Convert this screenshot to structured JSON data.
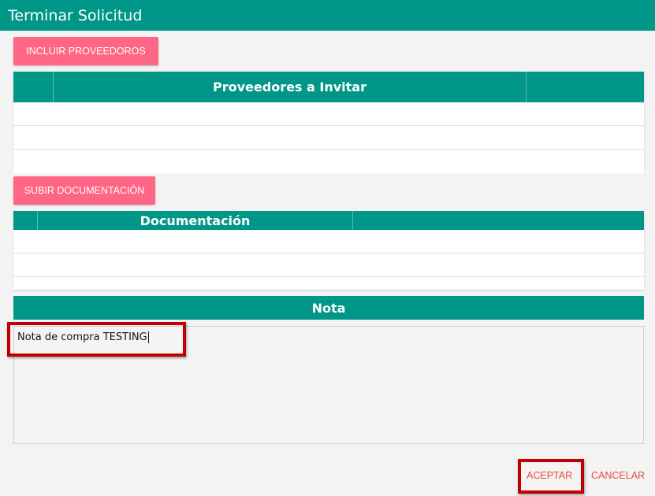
{
  "dialog": {
    "title": "Terminar Solicitud"
  },
  "proveedores": {
    "button_label": "INCLUIR PROVEEDOROS",
    "table_header": "Proveedores a Invitar",
    "rows": 3
  },
  "documentacion": {
    "button_label": "SUBIR DOCUMENTACIÓN",
    "table_header": "Documentación",
    "rows": 2
  },
  "nota": {
    "header": "Nota",
    "value": "Nota de compra TESTING"
  },
  "footer": {
    "accept_label": "ACEPTAR",
    "cancel_label": "CANCELAR"
  },
  "colors": {
    "primary": "#009688",
    "pink": "#ff6584",
    "danger_text": "#e84d3d",
    "highlight": "#c00000"
  }
}
